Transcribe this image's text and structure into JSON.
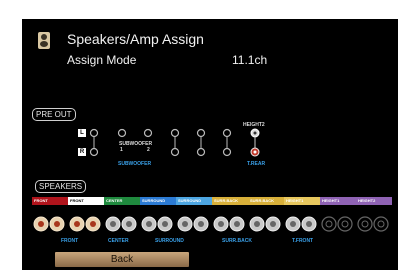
{
  "header": {
    "title": "Speakers/Amp Assign",
    "assign_mode_label": "Assign Mode",
    "assign_mode_value": "11.1ch"
  },
  "preout": {
    "section_label": "PRE OUT",
    "left_marker": "L",
    "right_marker": "R",
    "subwoofer_label": "SUBWOOFER",
    "subwoofer_num1": "1",
    "subwoofer_num2": "2",
    "subwoofer_assigned": "SUBWOOFER",
    "height2_label": "HEIGHT2",
    "trear_label": "T.REAR"
  },
  "speakers": {
    "section_label": "SPEAKERS",
    "channels": [
      {
        "label": "FRONT",
        "color": "#b0141c"
      },
      {
        "label": "FRONT",
        "color": "#ffffff"
      },
      {
        "label": "CENTER",
        "color": "#1f8a3e"
      },
      {
        "label": "SURROUND",
        "color": "#2c7bd4"
      },
      {
        "label": "SURROUND",
        "color": "#4da6e2"
      },
      {
        "label": "SURR.BACK",
        "color": "#d8b03a"
      },
      {
        "label": "SURR.BACK",
        "color": "#d8b03a"
      },
      {
        "label": "HEIGHT1",
        "color": "#e7c75e"
      },
      {
        "label": "HEIGHT1",
        "color": "#8f63b4"
      },
      {
        "label": "HEIGHT2",
        "color": "#8f63b4"
      }
    ],
    "assignments": [
      "FRONT",
      "CENTER",
      "SURROUND",
      "SURR.BACK",
      "T.FRONT"
    ]
  },
  "footer": {
    "back_label": "Back"
  }
}
